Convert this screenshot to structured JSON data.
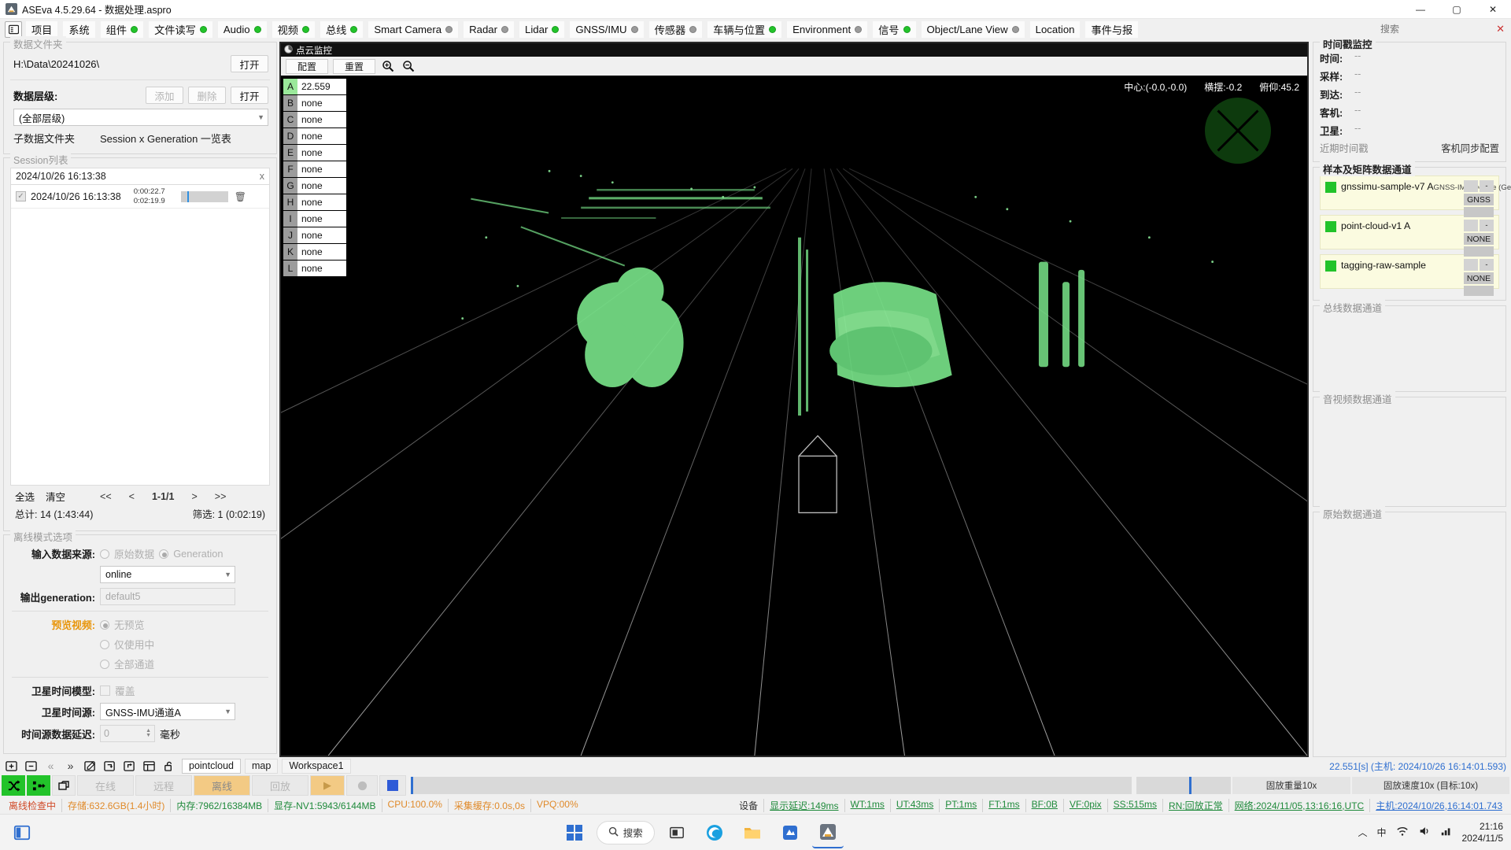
{
  "window": {
    "title": "ASEva 4.5.29.64 - 数据处理.aspro",
    "minimize": "—",
    "maximize": "▢",
    "close": "✕"
  },
  "menu": {
    "panel_icon": "panel-toggle-icon",
    "items": [
      {
        "label": "项目",
        "status": null
      },
      {
        "label": "系统",
        "status": null
      },
      {
        "label": "组件",
        "status": "on"
      },
      {
        "label": "文件读写",
        "status": "on"
      },
      {
        "label": "Audio",
        "status": "on"
      },
      {
        "label": "视频",
        "status": "on"
      },
      {
        "label": "总线",
        "status": "on"
      },
      {
        "label": "Smart Camera",
        "status": "off"
      },
      {
        "label": "Radar",
        "status": "off"
      },
      {
        "label": "Lidar",
        "status": "on"
      },
      {
        "label": "GNSS/IMU",
        "status": "off"
      },
      {
        "label": "传感器",
        "status": "off"
      },
      {
        "label": "车辆与位置",
        "status": "on"
      },
      {
        "label": "Environment",
        "status": "off"
      },
      {
        "label": "信号",
        "status": "on"
      },
      {
        "label": "Object/Lane View",
        "status": "off"
      },
      {
        "label": "Location",
        "status": null
      },
      {
        "label": "事件与报",
        "status": null
      }
    ],
    "search_placeholder": "搜索",
    "search_clear": "✕"
  },
  "left": {
    "data_folder": {
      "legend": "数据文件夹",
      "path": "H:\\Data\\20241026\\",
      "open_label": "打开",
      "level_label": "数据层级:",
      "add_label": "添加",
      "delete_label": "删除",
      "open2_label": "打开",
      "level_value": "(全部层级)",
      "sub_label": "子数据文件夹",
      "sub_value": "Session x Generation 一览表"
    },
    "session": {
      "legend": "Session列表",
      "header": "2024/10/26 16:13:38",
      "header_close": "x",
      "row": {
        "checked": "✓",
        "name": "2024/10/26 16:13:38",
        "t1": "0:00:22.7",
        "t2": "0:02:19.9",
        "delete_icon": "trash-icon"
      }
    },
    "pager": {
      "select_all": "全选",
      "clear": "清空",
      "first": "<<",
      "prev": "<",
      "page": "1-1/1",
      "next": ">",
      "last": ">>",
      "total": "总计: 14 (1:43:44)",
      "filtered": "筛选: 1 (0:02:19)"
    },
    "offline": {
      "legend": "离线模式选项",
      "input_source_label": "输入数据来源:",
      "opt_raw": "原始数据",
      "opt_generation": "Generation",
      "generation_value": "online",
      "output_label": "输出generation:",
      "output_value": "default5",
      "preview_label": "预览视频:",
      "preview_none": "无预览",
      "preview_used": "仅使用中",
      "preview_all": "全部通道",
      "sat_model_label": "卫星时间模型:",
      "sat_model_opt": "覆盖",
      "sat_src_label": "卫星时间源:",
      "sat_src_value": "GNSS-IMU通道A",
      "delay_label": "时间源数据延迟:",
      "delay_value": "0",
      "delay_unit": "毫秒"
    }
  },
  "pointcloud": {
    "title": "点云监控",
    "btn_config": "配置",
    "btn_reset": "重置",
    "zoom_in_icon": "zoom-in-icon",
    "zoom_out_icon": "zoom-out-icon",
    "channels": [
      {
        "key": "A",
        "value": "22.559",
        "active": true
      },
      {
        "key": "B",
        "value": "none",
        "active": false
      },
      {
        "key": "C",
        "value": "none",
        "active": false
      },
      {
        "key": "D",
        "value": "none",
        "active": false
      },
      {
        "key": "E",
        "value": "none",
        "active": false
      },
      {
        "key": "F",
        "value": "none",
        "active": false
      },
      {
        "key": "G",
        "value": "none",
        "active": false
      },
      {
        "key": "H",
        "value": "none",
        "active": false
      },
      {
        "key": "I",
        "value": "none",
        "active": false
      },
      {
        "key": "J",
        "value": "none",
        "active": false
      },
      {
        "key": "K",
        "value": "none",
        "active": false
      },
      {
        "key": "L",
        "value": "none",
        "active": false
      }
    ],
    "hud": {
      "center": "中心:(-0.0,-0.0)",
      "yaw": "横摆:-0.2",
      "pitch": "俯仰:45.2"
    }
  },
  "right": {
    "timestamp": {
      "legend": "时间戳监控",
      "rows": [
        {
          "k": "时间:",
          "v": "--"
        },
        {
          "k": "采样:",
          "v": "--"
        },
        {
          "k": "到达:",
          "v": "--"
        },
        {
          "k": "客机:",
          "v": "--"
        },
        {
          "k": "卫星:",
          "v": "--"
        }
      ],
      "recent": "近期时间戳",
      "sync_cfg": "客机同步配置"
    },
    "sample_matrix": {
      "legend": "样本及矩阵数据通道",
      "cards": [
        {
          "name": "gnssimu-sample-v7 A",
          "sub": "GNSS-IMU Device (Generation)",
          "b1": "-",
          "b2": "GNSS"
        },
        {
          "name": "point-cloud-v1 A",
          "sub": "",
          "b1": "-",
          "b2": "NONE"
        },
        {
          "name": "tagging-raw-sample",
          "sub": "",
          "b1": "-",
          "b2": "NONE"
        }
      ]
    },
    "bus_channels": {
      "legend": "总线数据通道"
    },
    "av_channels": {
      "legend": "音视频数据通道"
    },
    "raw_channels": {
      "legend": "原始数据通道"
    }
  },
  "workspace": {
    "icons": [
      "add-panel-icon",
      "remove-panel-icon",
      "prev-icon",
      "next-icon",
      "edit-icon",
      "import-icon",
      "export-icon",
      "layout-icon",
      "lock-icon"
    ],
    "tabs": [
      {
        "label": "pointcloud",
        "active": true
      },
      {
        "label": "map",
        "active": false
      },
      {
        "label": "Workspace1",
        "active": false
      }
    ],
    "time_right": "22.551[s] (主机: 2024/10/26 16:14:01.593)"
  },
  "controls": {
    "shuffle_icon": "shuffle-icon",
    "nodes_icon": "nodes-icon",
    "copy_icon": "copy-icon",
    "mode_online": "在线",
    "mode_remote": "远程",
    "mode_offline": "离线",
    "mode_replay": "回放",
    "play_icon": "play-icon",
    "record_icon": "record-icon",
    "stop_icon": "stop-icon",
    "fixed_volume": "固放重量10x",
    "fixed_speed": "固放速度10x (目标:10x)"
  },
  "status": {
    "left": [
      {
        "text": "离线检查中",
        "color": "red"
      },
      {
        "text": "存储:632.6GB(1.4小时)",
        "color": "orange"
      },
      {
        "text": "内存:7962/16384MB",
        "color": "green"
      },
      {
        "text": "显存-NV1:5943/6144MB",
        "color": "green"
      },
      {
        "text": "CPU:100.0%",
        "color": "orange"
      },
      {
        "text": "采集缓存:0.0s,0s",
        "color": "orange"
      },
      {
        "text": "VPQ:00%",
        "color": "orange"
      }
    ],
    "right": [
      {
        "text": "设备",
        "color": "plain"
      },
      {
        "text": "显示延迟:149ms",
        "color": "green"
      },
      {
        "text": "WT:1ms",
        "color": "green"
      },
      {
        "text": "UT:43ms",
        "color": "green"
      },
      {
        "text": "PT:1ms",
        "color": "green"
      },
      {
        "text": "FT:1ms",
        "color": "green"
      },
      {
        "text": "BF:0B",
        "color": "green"
      },
      {
        "text": "VF:0pix",
        "color": "green"
      },
      {
        "text": "SS:515ms",
        "color": "green"
      },
      {
        "text": "RN:回放正常",
        "color": "green"
      },
      {
        "text": "网络:2024/11/05,13:16:16,UTC",
        "color": "green"
      },
      {
        "text": "主机:2024/10/26,16:14:01.743",
        "color": "blue"
      }
    ]
  },
  "taskbar": {
    "start_icon": "windows-start-icon",
    "search_text": "搜索",
    "search_icon": "search-icon",
    "icons": [
      "task-view-icon",
      "edge-icon",
      "explorer-icon",
      "store-icon",
      "aseva-icon"
    ],
    "tray": [
      "chevron-up-icon",
      "ime-cn-icon",
      "wifi-icon",
      "volume-icon",
      "network-icon"
    ],
    "ime": "中",
    "clock_time": "21:16",
    "clock_date": "2024/11/5"
  }
}
